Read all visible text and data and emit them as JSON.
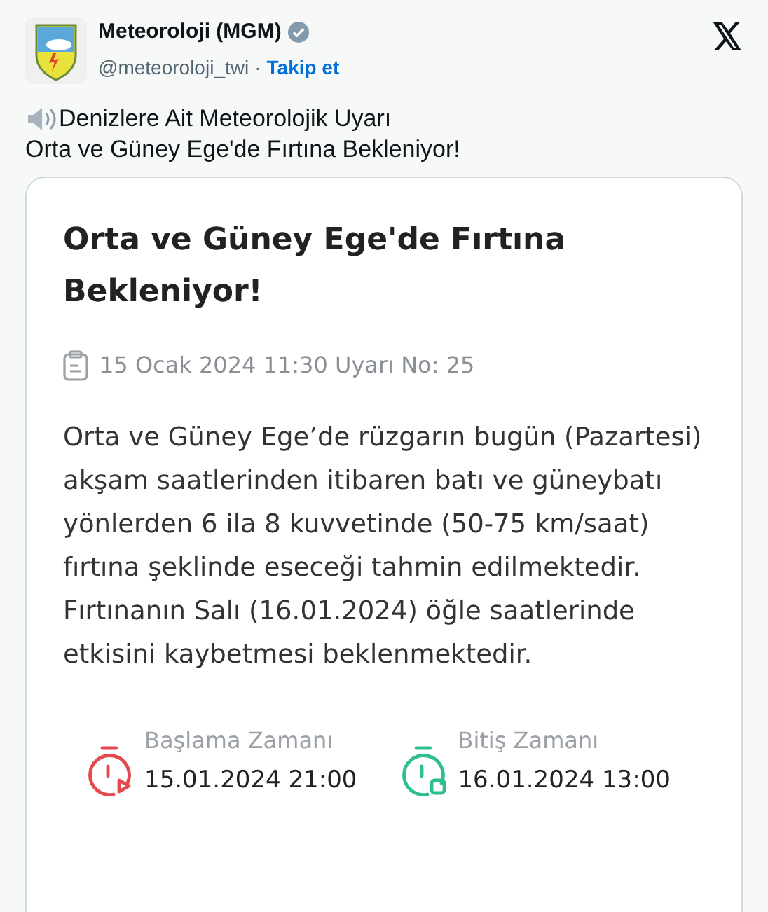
{
  "author": {
    "name": "Meteoroloji (MGM)",
    "handle": "@meteoroloji_twi",
    "separator": "·",
    "follow": "Takip et"
  },
  "post": {
    "lines": [
      "Denizlere Ait Meteorolojik Uyarı",
      "Orta ve Güney Ege'de Fırtına Bekleniyor!"
    ]
  },
  "card": {
    "title": "Orta ve Güney Ege'de Fırtına Bekleniyor!",
    "date": "15 Ocak 2024 11:30 Uyarı No: 25",
    "body": "Orta ve Güney Ege’de rüzgarın bugün (Pazartesi) akşam saatlerinden itibaren batı ve güneybatı yönlerden 6 ila 8 kuvvetinde (50-75 km/saat) fırtına şeklinde eseceği tahmin edilmektedir. Fırtınanın Salı (16.01.2024) öğle saatlerinde etkisini kaybetmesi beklenmektedir.",
    "times": [
      {
        "kind": "start",
        "label": "Başlama Zamanı",
        "value": "15.01.2024 21:00"
      },
      {
        "kind": "end",
        "label": "Bitiş Zamanı",
        "value": "16.01.2024 13:00"
      }
    ]
  }
}
